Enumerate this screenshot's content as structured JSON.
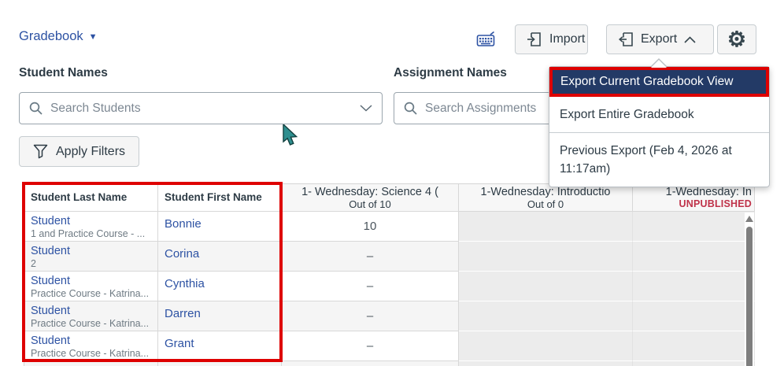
{
  "topbar": {
    "gradebook_label": "Gradebook",
    "import_label": "Import",
    "export_label": "Export"
  },
  "filters": {
    "student_names_label": "Student Names",
    "search_students_placeholder": "Search Students",
    "assignment_names_label": "Assignment Names",
    "search_assignments_placeholder": "Search Assignments",
    "apply_filters_label": "Apply Filters"
  },
  "export_menu": {
    "items": [
      {
        "label": "Export Current Gradebook View",
        "highlighted": true,
        "annotated": true,
        "divider_before": false
      },
      {
        "label": "Export Entire Gradebook",
        "highlighted": false,
        "annotated": false,
        "divider_before": false
      },
      {
        "label": "Previous Export (Feb 4, 2026 at 11:17am)",
        "highlighted": false,
        "annotated": false,
        "divider_before": true
      }
    ]
  },
  "table": {
    "columns": [
      {
        "label": "Student Last Name",
        "type": "student"
      },
      {
        "label": "Student First Name",
        "type": "student"
      },
      {
        "label": "1- Wednesday: Science 4 (",
        "sub": "Out of 10",
        "type": "assignment"
      },
      {
        "label": "1-Wednesday: Introductio",
        "sub": "Out of 0",
        "type": "assignment"
      },
      {
        "label": "1-Wednesday: In",
        "sub": "UNPUBLISHED",
        "type": "assignment-unpublished"
      }
    ],
    "rows": [
      {
        "last_name": "Student",
        "last_name_sub": "1 and Practice Course - ...",
        "first_name": "Bonnie",
        "score": "10"
      },
      {
        "last_name": "Student",
        "last_name_sub": "2",
        "first_name": "Corina",
        "score": "–"
      },
      {
        "last_name": "Student",
        "last_name_sub": "Practice Course - Katrina...",
        "first_name": "Cynthia",
        "score": "–"
      },
      {
        "last_name": "Student",
        "last_name_sub": "Practice Course - Katrina...",
        "first_name": "Darren",
        "score": "–"
      },
      {
        "last_name": "Student",
        "last_name_sub": "Practice Course - Katrina...",
        "first_name": "Grant",
        "score": "–"
      }
    ]
  },
  "colors": {
    "annotation_red": "#de0000",
    "menu_highlight_navy": "#233a66",
    "link_blue": "#2d52a3",
    "unpublished_red": "#bf3249",
    "ink": "#2d3b45",
    "row_stripe": "#f5f5f5",
    "disabled_cell": "#ececec"
  }
}
